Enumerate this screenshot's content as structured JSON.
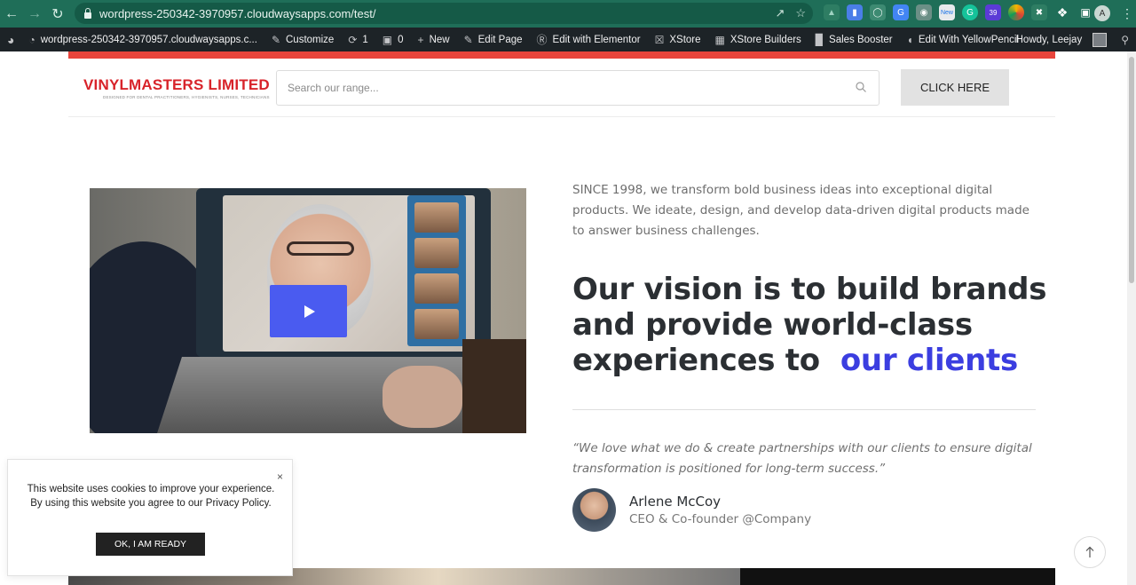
{
  "browser": {
    "url": "wordpress-250342-3970957.cloudwaysapps.com/test/",
    "profile_initial": "A",
    "extensions": [
      "google-drive-icon",
      "globe-icon",
      "google-translate-icon",
      "camera-icon",
      "new-badge-icon",
      "grammarly-icon",
      "extension-39-icon",
      "color-wheel-icon",
      "puzzle-icon",
      "sidebar-icon"
    ],
    "ext_badge_new": "New",
    "ext_badge_count": "39"
  },
  "adminbar": {
    "site_name": "wordpress-250342-3970957.cloudwaysapps.c...",
    "customize": "Customize",
    "updates_count": "1",
    "comments_count": "0",
    "new": "New",
    "edit_page": "Edit Page",
    "edit_elementor": "Edit with Elementor",
    "xstore": "XStore",
    "xstore_builders": "XStore Builders",
    "sales_booster": "Sales Booster",
    "yellowpencil": "Edit With YellowPencil",
    "howdy": "Howdy, Leejay"
  },
  "header": {
    "logo_text": "VINYLMASTERS LIMITED",
    "logo_tagline": "DESIGNED FOR DENTAL PRACTITIONERS, HYGIENISTS, NURSES, TECHNICIANS",
    "search_placeholder": "Search our range...",
    "cta_label": "CLICK HERE"
  },
  "hero": {
    "intro": "SINCE 1998, we transform bold business ideas into exceptional digital products. We ideate, design, and develop data-driven digital products made to answer business challenges.",
    "headline": "Our vision is to build brands and provide world-class experiences to",
    "headline_accent": "our clients",
    "quote": "“We love what we do & create partnerships with our clients to ensure digital transformation is positioned for long-term success.”",
    "person_name": "Arlene McCoy",
    "person_role": "CEO & Co-founder @Company"
  },
  "cookie": {
    "message_prefix": "This website uses cookies to improve your experience. By using this website you agree to our ",
    "policy_link": "Privacy Policy",
    "message_suffix": ".",
    "button": "OK, I AM READY",
    "close": "×"
  },
  "colors": {
    "chrome": "#1f6e58",
    "adminbar": "#1d2327",
    "brand_red": "#d8232a",
    "accent_blue": "#3b3ee0",
    "play_button": "#4a5bf0"
  }
}
